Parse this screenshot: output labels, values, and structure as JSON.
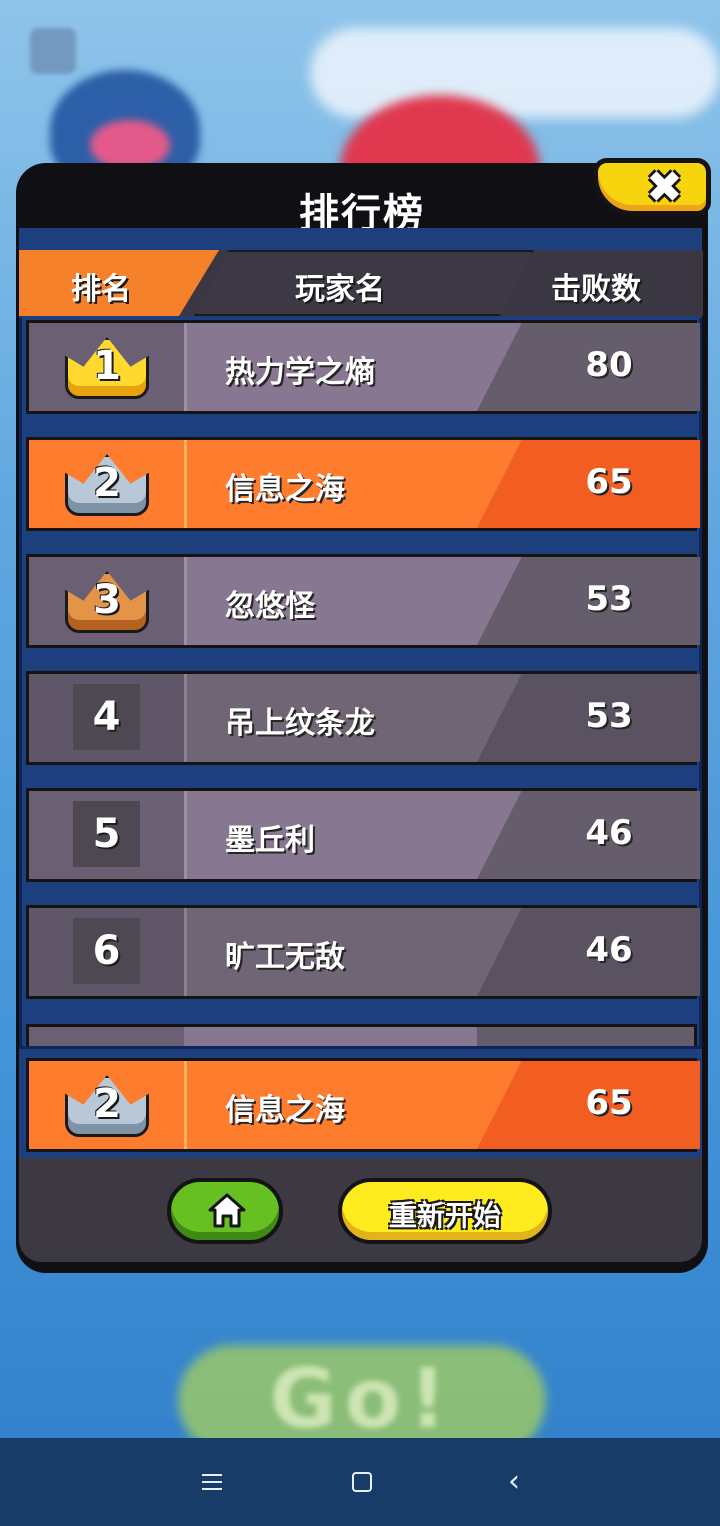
{
  "leaderboard": {
    "title": "排行榜",
    "headers": {
      "rank": "排名",
      "player": "玩家名",
      "kills": "击败数"
    },
    "rows": [
      {
        "rank": "1",
        "name": "热力学之熵",
        "kills": "80",
        "medal": "gold-crown"
      },
      {
        "rank": "2",
        "name": "信息之海",
        "kills": "65",
        "medal": "silver-crown",
        "is_me": true
      },
      {
        "rank": "3",
        "name": "忽悠怪",
        "kills": "53",
        "medal": "bronze-crown"
      },
      {
        "rank": "4",
        "name": "吊上纹条龙",
        "kills": "53"
      },
      {
        "rank": "5",
        "name": "墨丘利",
        "kills": "46"
      },
      {
        "rank": "6",
        "name": "旷工无敌",
        "kills": "46"
      }
    ],
    "my_row": {
      "rank": "2",
      "name": "信息之海",
      "kills": "65",
      "medal": "silver-crown"
    }
  },
  "buttons": {
    "close_icon": "close-x-icon",
    "home_icon": "home-icon",
    "restart_label": "重新开始"
  },
  "background": {
    "go_button_label": "Go!"
  },
  "navbar": {
    "menu_icon": "menu-icon",
    "home_icon": "square-home-icon",
    "back_icon": "back-chevron-icon"
  },
  "colors": {
    "accent_orange": "#fd7c2e",
    "panel_blue": "#1d3f7d",
    "close_yellow": "#f6d50f",
    "home_green": "#66c022",
    "restart_yellow": "#ffec1f"
  }
}
